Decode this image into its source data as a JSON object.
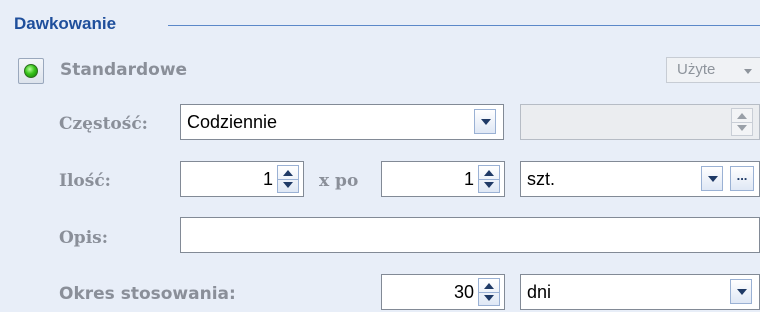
{
  "group": {
    "title": "Dawkowanie"
  },
  "standard": {
    "label": "Standardowe",
    "status_color": "#38c31a"
  },
  "used_dropdown": {
    "value": "Użyte"
  },
  "frequency": {
    "label": "Częstość:",
    "value": "Codziennie",
    "extra_value": ""
  },
  "quantity": {
    "label": "Ilość:",
    "count": "1",
    "separator": "x po",
    "dose": "1",
    "unit": "szt.",
    "more_button": "..."
  },
  "description": {
    "label": "Opis:",
    "value": ""
  },
  "period": {
    "label": "Okres stosowania:",
    "value": "30",
    "unit": "dni"
  }
}
